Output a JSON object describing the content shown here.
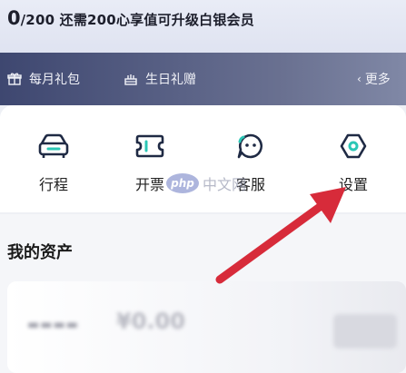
{
  "membership": {
    "points_current": "0",
    "points_rest": "/200 还需200心享值可升级白银会员"
  },
  "benefits": {
    "monthly_gift": "每月礼包",
    "birthday_gift": "生日礼赠",
    "more_label": "更多",
    "gift_icon": "gift-icon",
    "cake_icon": "cake-icon"
  },
  "actions": [
    {
      "label": "行程",
      "icon": "car-icon"
    },
    {
      "label": "开票",
      "icon": "ticket-icon"
    },
    {
      "label": "客服",
      "icon": "chat-face-icon"
    },
    {
      "label": "设置",
      "icon": "hexagon-settings-icon"
    }
  ],
  "watermark": {
    "logo": "php",
    "text": "中文网"
  },
  "assets": {
    "title": "我的资产",
    "value_blurred": "¥0.00"
  },
  "colors": {
    "accent_icon": "#1f2a44",
    "benefits_bar": "#4b5478",
    "annotation_arrow": "#d72b3a"
  }
}
